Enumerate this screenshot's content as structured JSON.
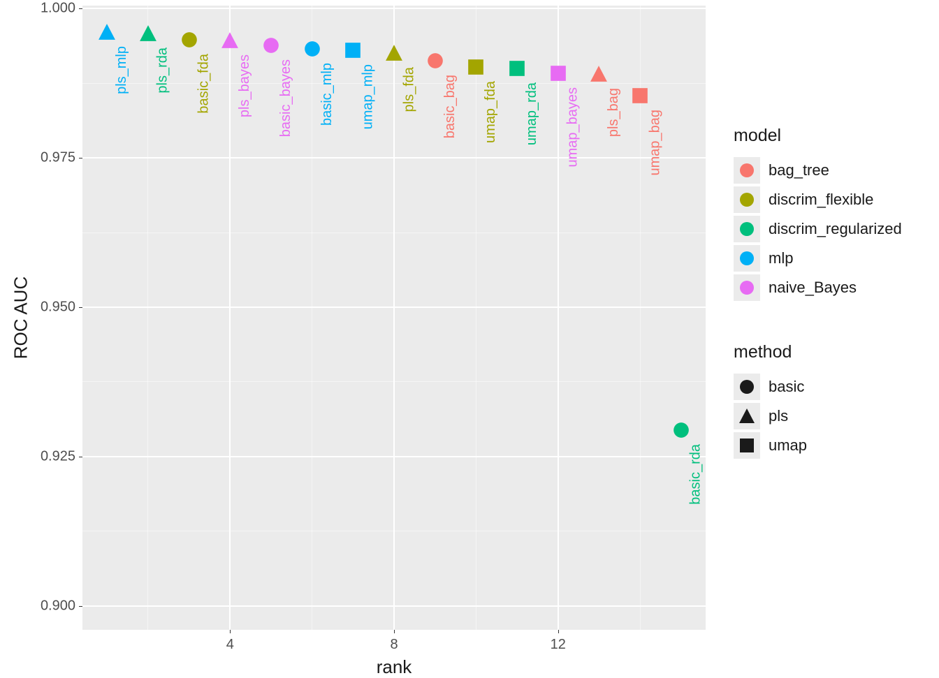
{
  "chart_data": {
    "type": "scatter",
    "xlabel": "rank",
    "ylabel": "ROC AUC",
    "xlim": [
      0.4,
      15.6
    ],
    "ylim": [
      0.896,
      1.0005
    ],
    "x_ticks": [
      4,
      8,
      12
    ],
    "y_ticks": [
      0.9,
      0.925,
      0.95,
      0.975,
      1.0
    ],
    "models": {
      "bag_tree": "#F8766D",
      "discrim_flexible": "#A3A500",
      "discrim_regularized": "#00BF7D",
      "mlp": "#00B0F6",
      "naive_Bayes": "#E76BF3"
    },
    "methods": {
      "basic": "circle",
      "pls": "triangle",
      "umap": "square"
    },
    "points": [
      {
        "rank": 1,
        "roc_auc": 0.996,
        "label": "pls_mlp",
        "model": "mlp",
        "method": "pls"
      },
      {
        "rank": 2,
        "roc_auc": 0.9958,
        "label": "pls_rda",
        "model": "discrim_regularized",
        "method": "pls"
      },
      {
        "rank": 3,
        "roc_auc": 0.9948,
        "label": "basic_fda",
        "model": "discrim_flexible",
        "method": "basic"
      },
      {
        "rank": 4,
        "roc_auc": 0.9946,
        "label": "pls_bayes",
        "model": "naive_Bayes",
        "method": "pls"
      },
      {
        "rank": 5,
        "roc_auc": 0.9938,
        "label": "basic_bayes",
        "model": "naive_Bayes",
        "method": "basic"
      },
      {
        "rank": 6,
        "roc_auc": 0.9932,
        "label": "basic_mlp",
        "model": "mlp",
        "method": "basic"
      },
      {
        "rank": 7,
        "roc_auc": 0.993,
        "label": "umap_mlp",
        "model": "mlp",
        "method": "umap"
      },
      {
        "rank": 8,
        "roc_auc": 0.9925,
        "label": "pls_fda",
        "model": "discrim_flexible",
        "method": "pls"
      },
      {
        "rank": 9,
        "roc_auc": 0.9913,
        "label": "basic_bag",
        "model": "bag_tree",
        "method": "basic"
      },
      {
        "rank": 10,
        "roc_auc": 0.9902,
        "label": "umap_fda",
        "model": "discrim_flexible",
        "method": "umap"
      },
      {
        "rank": 11,
        "roc_auc": 0.99,
        "label": "umap_rda",
        "model": "discrim_regularized",
        "method": "umap"
      },
      {
        "rank": 12,
        "roc_auc": 0.9892,
        "label": "umap_bayes",
        "model": "naive_Bayes",
        "method": "umap"
      },
      {
        "rank": 13,
        "roc_auc": 0.989,
        "label": "pls_bag",
        "model": "bag_tree",
        "method": "pls"
      },
      {
        "rank": 14,
        "roc_auc": 0.9854,
        "label": "umap_bag",
        "model": "bag_tree",
        "method": "umap"
      },
      {
        "rank": 15,
        "roc_auc": 0.9294,
        "label": "basic_rda",
        "model": "discrim_regularized",
        "method": "basic"
      }
    ],
    "legend_model_title": "model",
    "legend_model_items": [
      {
        "key": "bag_tree",
        "label": "bag_tree"
      },
      {
        "key": "discrim_flexible",
        "label": "discrim_flexible"
      },
      {
        "key": "discrim_regularized",
        "label": "discrim_regularized"
      },
      {
        "key": "mlp",
        "label": "mlp"
      },
      {
        "key": "naive_Bayes",
        "label": "naive_Bayes"
      }
    ],
    "legend_method_title": "method",
    "legend_method_items": [
      {
        "key": "basic",
        "label": "basic"
      },
      {
        "key": "pls",
        "label": "pls"
      },
      {
        "key": "umap",
        "label": "umap"
      }
    ],
    "y_tick_labels": [
      "0.900",
      "0.925",
      "0.950",
      "0.975",
      "1.000"
    ],
    "x_tick_labels": [
      "4",
      "8",
      "12"
    ]
  }
}
